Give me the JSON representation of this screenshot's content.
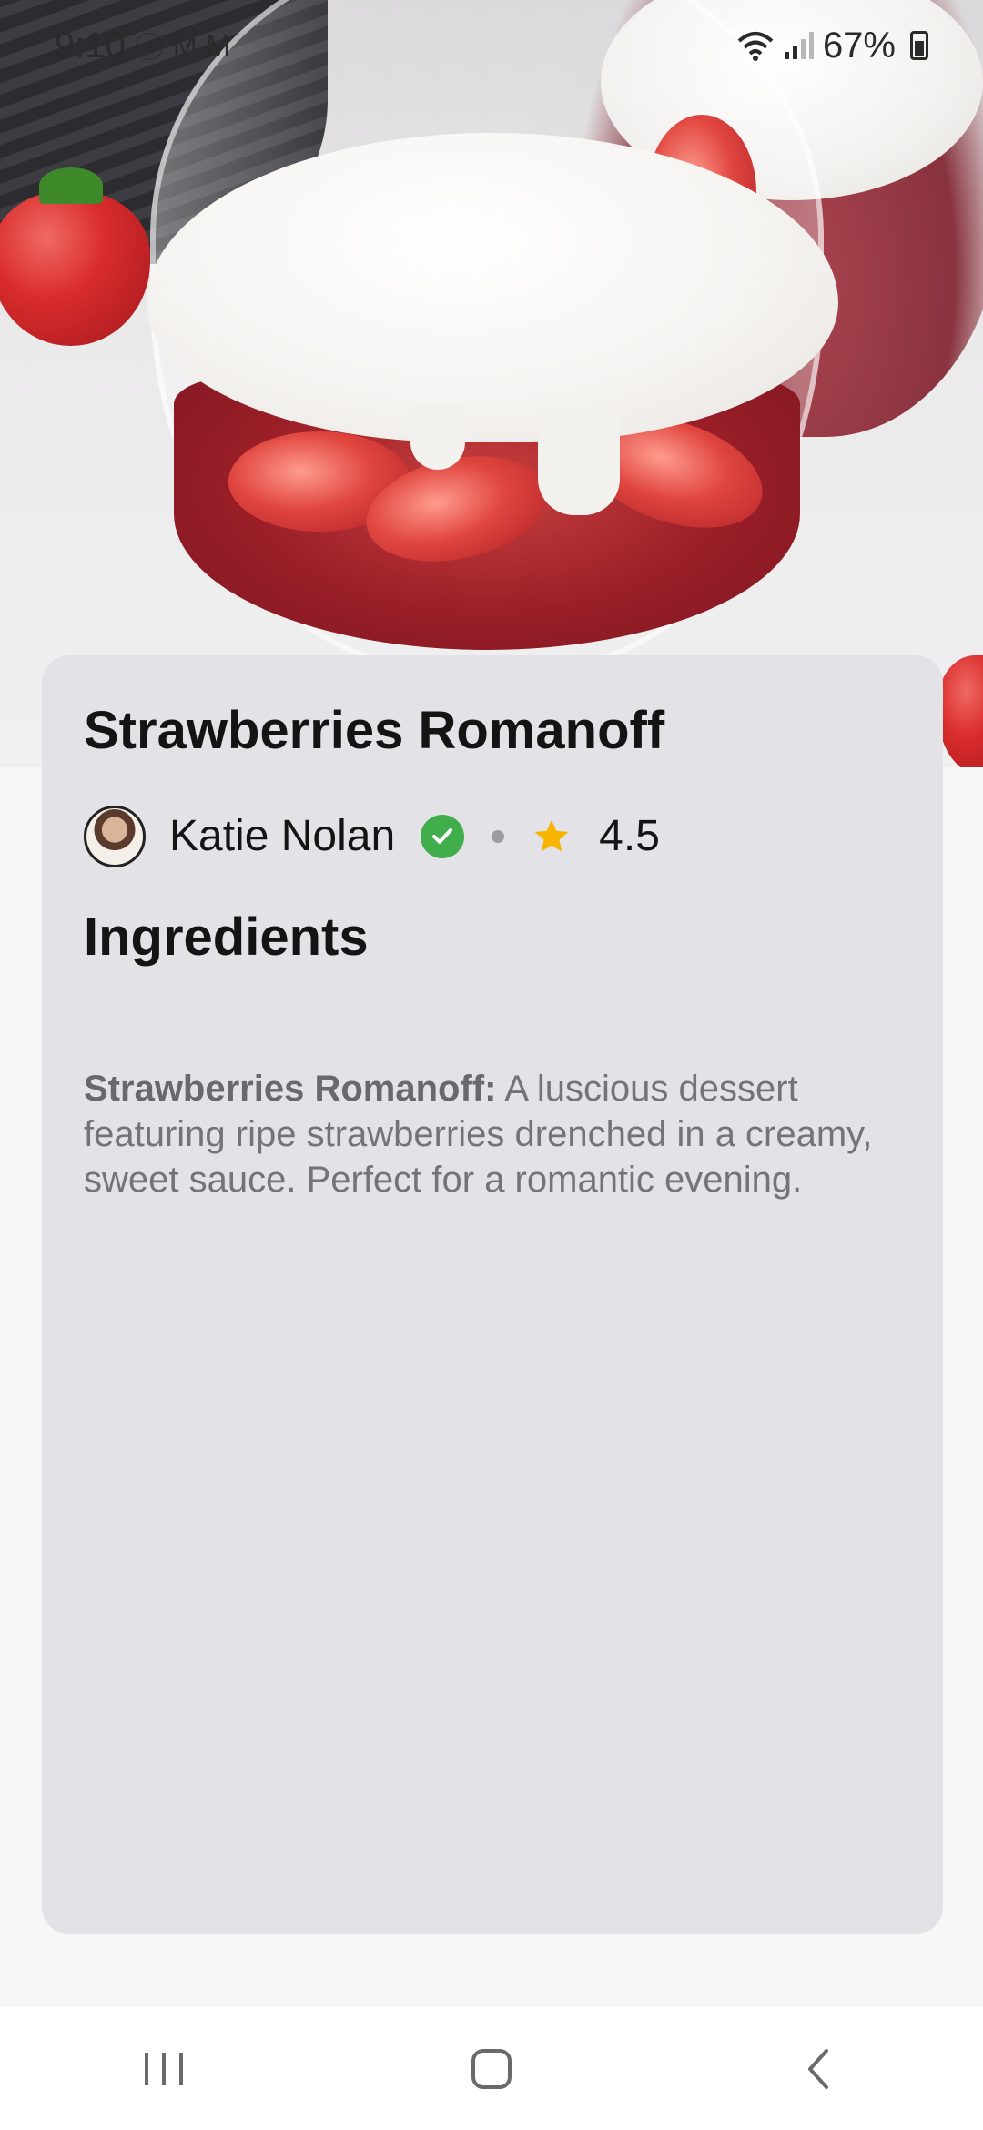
{
  "status_bar": {
    "time": "9:10",
    "notification_icons": [
      "dollar-icon",
      "gmail-icon",
      "gmail-icon"
    ],
    "battery": "67%"
  },
  "recipe": {
    "title": "Strawberries Romanoff",
    "author": {
      "name": "Katie Nolan",
      "verified": true
    },
    "rating": "4.5",
    "section_title": "Ingredients",
    "description_label": "Strawberries Romanoff:",
    "description_text": " A luscious dessert featuring ripe strawberries drenched in a creamy, sweet sauce. Perfect for a romantic evening."
  },
  "colors": {
    "card_bg": "#e3e2e7",
    "verified_green": "#3fae4b",
    "star_yellow": "#f7b500",
    "text_primary": "#141414",
    "text_secondary": "#73737a"
  },
  "navigation": {
    "buttons": [
      "recents-icon",
      "home-icon",
      "back-icon"
    ]
  }
}
